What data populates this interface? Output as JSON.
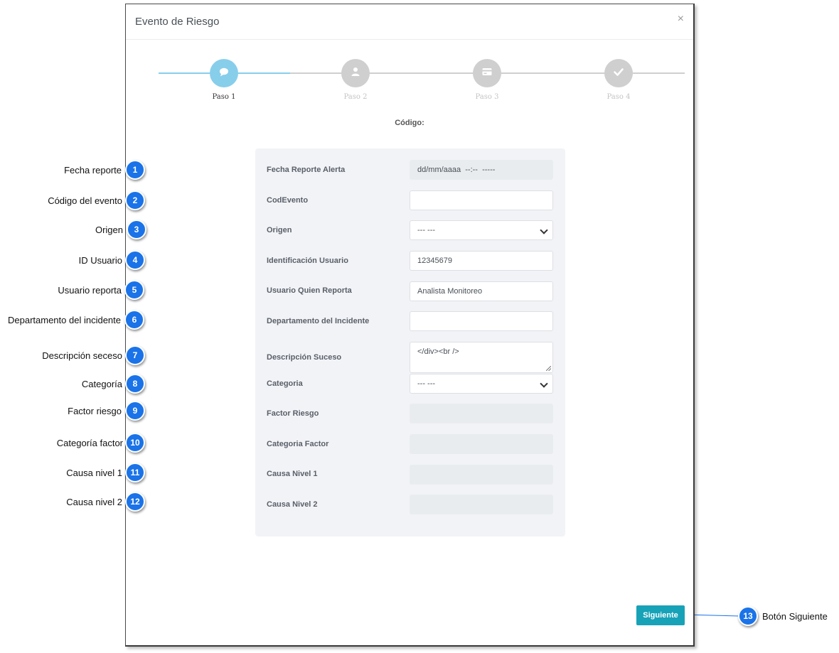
{
  "modal": {
    "title": "Evento de Riesgo",
    "close": "×",
    "code_label": "Código:",
    "next_button": "Siguiente"
  },
  "steps": [
    {
      "label": "Paso 1",
      "icon": "comment-icon",
      "active": true
    },
    {
      "label": "Paso 2",
      "icon": "user-icon",
      "active": false
    },
    {
      "label": "Paso 3",
      "icon": "credit-card-icon",
      "active": false
    },
    {
      "label": "Paso 4",
      "icon": "check-icon",
      "active": false
    }
  ],
  "form": {
    "fields": [
      {
        "label": "Fecha Reporte Alerta",
        "value": "dd/mm/aaaa  --:--  -----",
        "type": "datetime",
        "disabled": true
      },
      {
        "label": "CodEvento",
        "value": "",
        "type": "text"
      },
      {
        "label": "Origen",
        "value": "--- ---",
        "type": "select"
      },
      {
        "label": "Identificación Usuario",
        "value": "12345679",
        "type": "text"
      },
      {
        "label": "Usuario Quien Reporta",
        "value": "Analista Monitoreo",
        "type": "text"
      },
      {
        "label": "Departamento del Incidente",
        "value": "",
        "type": "text"
      },
      {
        "label": "Descripción Suceso",
        "value": "</div><br />",
        "type": "textarea"
      },
      {
        "label": "Categoria",
        "value": "--- ---",
        "type": "select"
      },
      {
        "label": "Factor Riesgo",
        "value": "",
        "type": "text",
        "disabled": true
      },
      {
        "label": "Categoria Factor",
        "value": "",
        "type": "text",
        "disabled": true
      },
      {
        "label": "Causa Nivel 1",
        "value": "",
        "type": "text",
        "disabled": true
      },
      {
        "label": "Causa Nivel 2",
        "value": "",
        "type": "text",
        "disabled": true
      }
    ]
  },
  "callouts": [
    {
      "number": "1",
      "text": "Fecha reporte"
    },
    {
      "number": "2",
      "text": "Código del evento"
    },
    {
      "number": "3",
      "text": "Origen"
    },
    {
      "number": "4",
      "text": "ID Usuario"
    },
    {
      "number": "5",
      "text": "Usuario reporta"
    },
    {
      "number": "6",
      "text": "Departamento del incidente"
    },
    {
      "number": "7",
      "text": "Descripción seceso"
    },
    {
      "number": "8",
      "text": "Categoría"
    },
    {
      "number": "9",
      "text": "Factor riesgo"
    },
    {
      "number": "10",
      "text": "Categoría factor"
    },
    {
      "number": "11",
      "text": "Causa nivel 1"
    },
    {
      "number": "12",
      "text": "Causa nivel 2"
    },
    {
      "number": "13",
      "text": "Botón Siguiente"
    }
  ],
  "colors": {
    "active_step": "#87ceeb",
    "inactive_step": "#cfcfcf",
    "badge": "#1a73e8",
    "callout_line": "#1a73e8",
    "primary_button": "#17a2b8",
    "panel_bg": "#f2f3f6"
  }
}
